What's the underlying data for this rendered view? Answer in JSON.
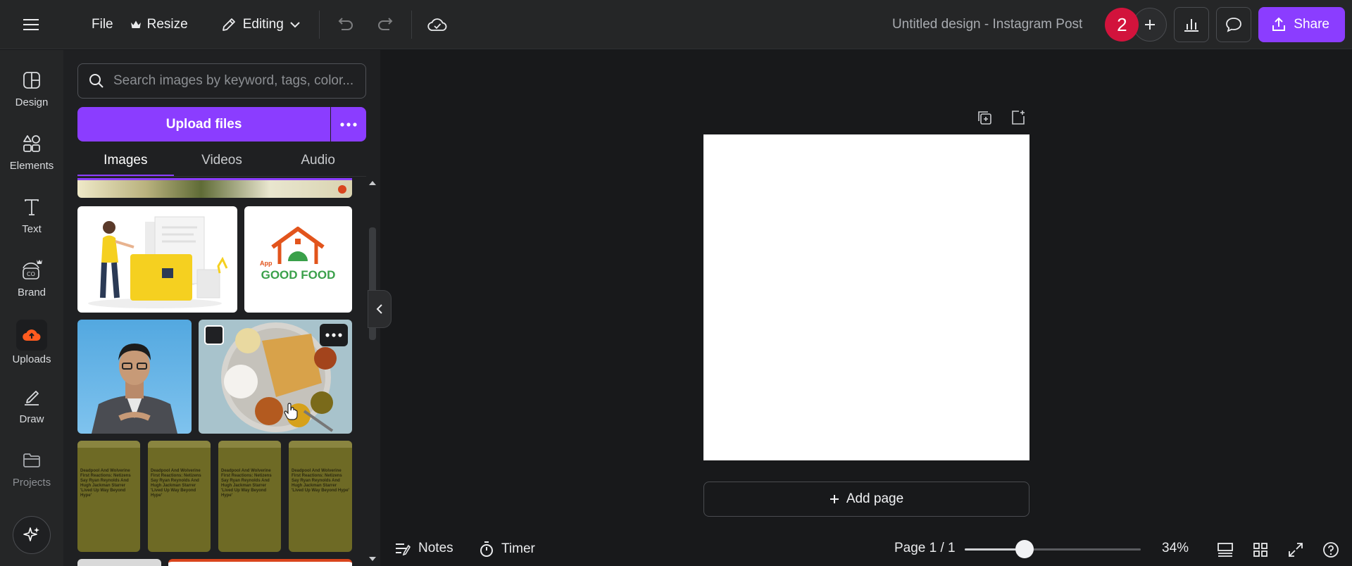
{
  "topbar": {
    "file_label": "File",
    "resize_label": "Resize",
    "mode_label": "Editing",
    "doc_title": "Untitled design - Instagram Post",
    "collaborator_count": "2",
    "share_label": "Share"
  },
  "rail": {
    "items": [
      {
        "label": "Design",
        "icon": "layout-icon"
      },
      {
        "label": "Elements",
        "icon": "shapes-icon"
      },
      {
        "label": "Text",
        "icon": "text-icon"
      },
      {
        "label": "Brand",
        "icon": "brand-crown-icon"
      },
      {
        "label": "Uploads",
        "icon": "cloud-upload-icon"
      },
      {
        "label": "Draw",
        "icon": "pen-icon"
      },
      {
        "label": "Projects",
        "icon": "folder-icon"
      }
    ]
  },
  "panel": {
    "search_placeholder": "Search images by keyword, tags, color...",
    "upload_label": "Upload files",
    "tabs": [
      "Images",
      "Videos",
      "Audio"
    ],
    "active_tab": "Images",
    "thumbnails": {
      "logo_prefix": "App",
      "logo_text": "GOOD FOOD",
      "article_title": "Deadpool And Wolverine First Reactions: Netizens Say Ryan Reynolds And Hugh Jackman Starrer 'Lived Up Way Beyond Hype'"
    }
  },
  "canvas": {
    "add_page_label": "Add page"
  },
  "bottombar": {
    "notes_label": "Notes",
    "timer_label": "Timer",
    "page_indicator": "Page 1 / 1",
    "zoom_label": "34%",
    "zoom_fraction": 0.34
  },
  "colors": {
    "accent": "#8b3dff",
    "avatar": "#d2133c",
    "background": "#18191b",
    "chrome": "#252627"
  }
}
